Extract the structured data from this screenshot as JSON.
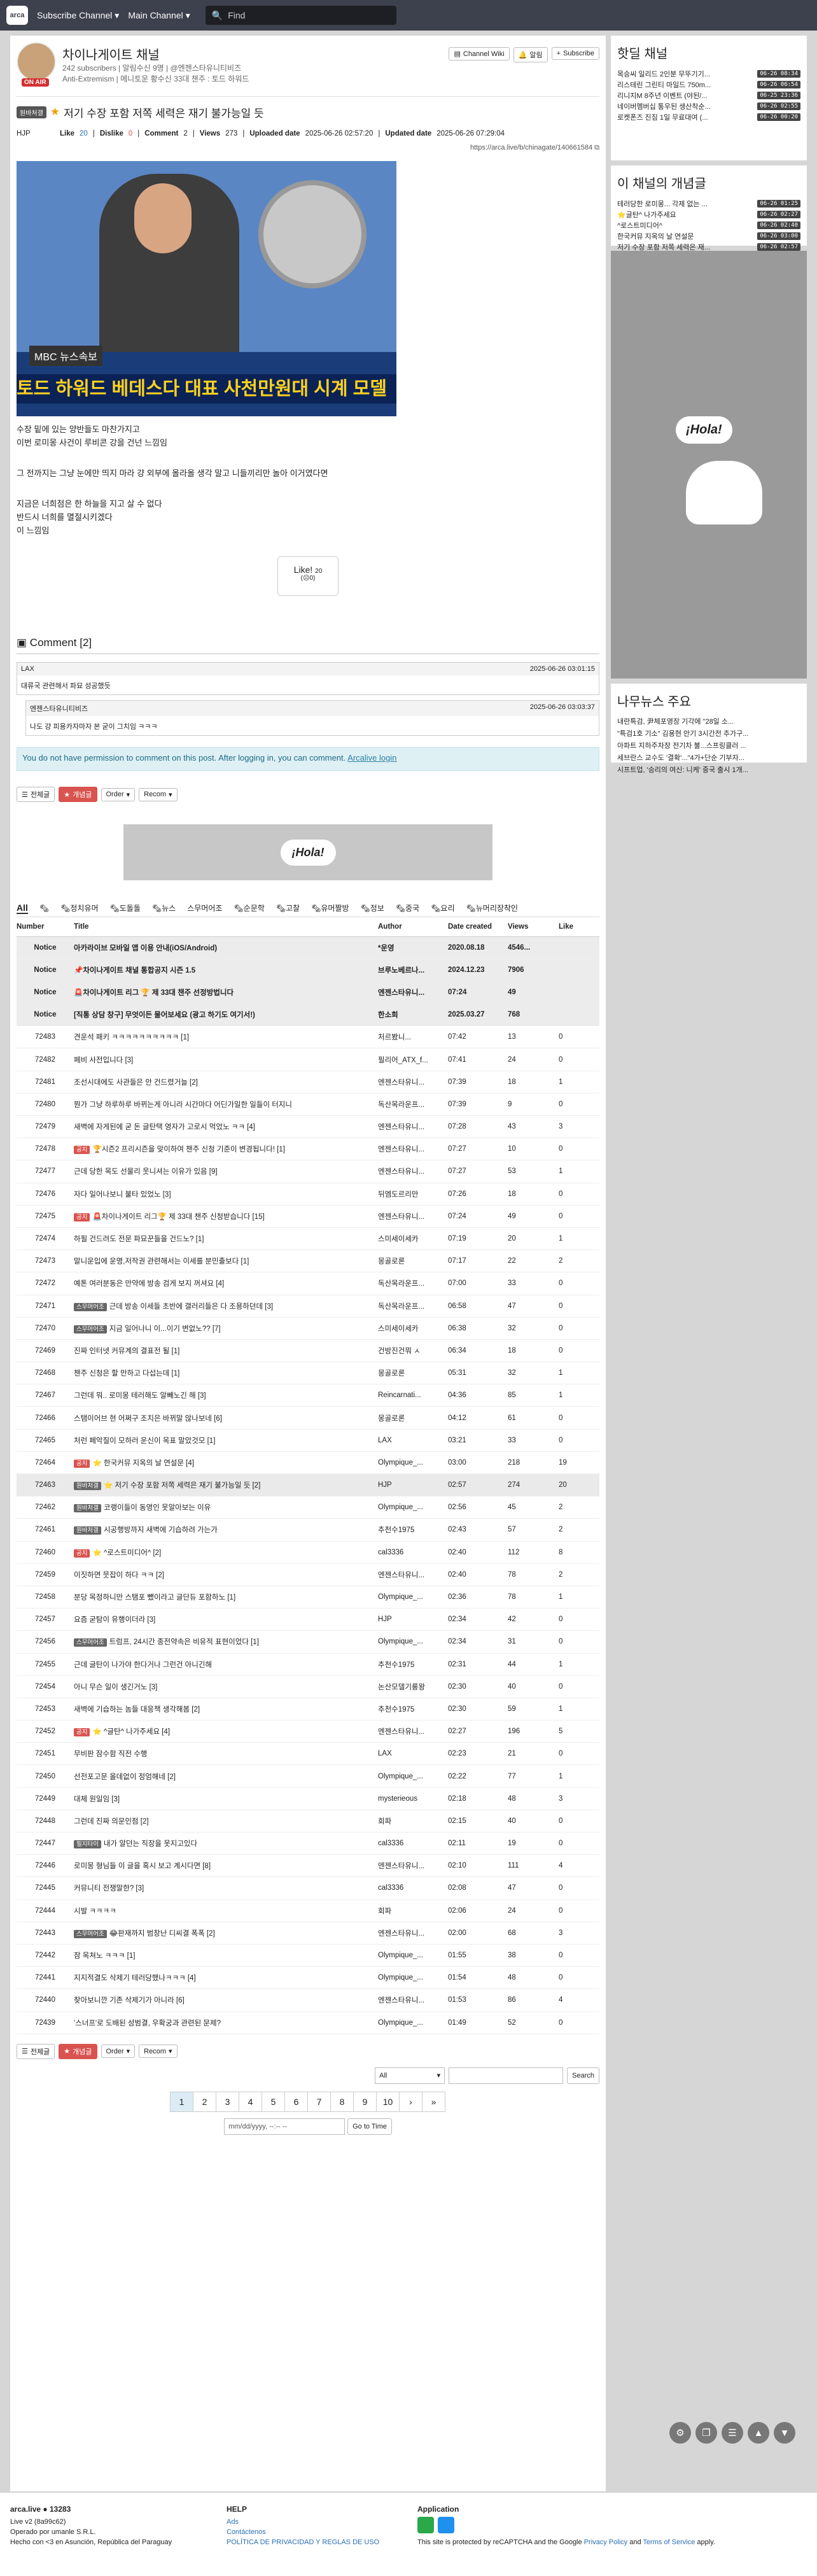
{
  "topbar": {
    "logo": "arca",
    "menu1": "Subscribe Channel",
    "menu2": "Main Channel",
    "search_placeholder": "Find"
  },
  "channel": {
    "name": "차이나게이트 채널",
    "stats": "242 subscribers | 알림수신 9명 | @엔젠스타유니티비즈",
    "desc": "Anti-Extremism | 메니토운 황수신 33대 챈주 : 토드 하워드",
    "onair": "ON AIR",
    "wiki": "Channel Wiki",
    "alert": "알림",
    "subscribe": "Subscribe"
  },
  "post": {
    "category": "원바처갤",
    "title": "저기 수장 포함 저쪽 세력은 재기 불가능일 듯",
    "author": "HJP",
    "like_label": "Like",
    "like": "20",
    "dislike_label": "Dislike",
    "dislike": "0",
    "comment_label": "Comment",
    "comment": "2",
    "views_label": "Views",
    "views": "273",
    "uploaded_label": "Uploaded date",
    "uploaded": "2025-06-26 02:57:20",
    "updated_label": "Updated date",
    "updated": "2025-06-26 07:29:04",
    "link": "https://arca.live/b/chinagate/140661584",
    "image_bug": "MBC 뉴스속보",
    "image_caption": "토드 하워드 베데스다 대표 사천만원대 시계 모델",
    "lines": [
      "수장 밑에 있는 양반들도 마찬가지고",
      "이번 로미몽 사건이 루비콘 강을 건넌 느낌임",
      "",
      "그 전까지는 그냥 눈에만 띄지 마라 걍 외부에 올라올 생각 말고 니들끼리만 놀아 이거였다면",
      "",
      "지금은 너희점은 한 하늘을 지고 살 수 없다",
      "반드시 너희를 멸절시키겠다",
      "이 느낌임"
    ],
    "like_btn": "Like!",
    "like_btn_count": "20",
    "like_btn_sub": "0"
  },
  "comments": {
    "title": "Comment",
    "count": "[2]",
    "items": [
      {
        "author": "LAX",
        "date": "2025-06-26 03:01:15",
        "text": "대류국 관련해서 파묘 성공했듯"
      },
      {
        "author": "엔젠스타유니티비즈",
        "date": "2025-06-26 03:03:37",
        "text": "나도 걍 피용카자마자 본 굳이 그치임 ㅋㅋㅋ"
      }
    ],
    "noperm": "You do not have permission to comment on this post. After logging in, you can comment.",
    "login": "Arcalive login"
  },
  "toolbar": {
    "all": "전체글",
    "best": "개념글",
    "order": "Order",
    "recom": "Recom"
  },
  "ad": {
    "text": "¡Hola!"
  },
  "tabs": [
    "All",
    "🗞",
    "🗞정치유머",
    "🗞도돌돌",
    "🗞뉴스",
    "스무머어조",
    "🗞순문학",
    "🗞고찰",
    "🗞유머짤방",
    "🗞정보",
    "🗞중국",
    "🗞요리",
    "🗞뉴머리장착인"
  ],
  "table": {
    "headers": [
      "Number",
      "Title",
      "Author",
      "Date created",
      "Views",
      "Like"
    ],
    "rows": [
      {
        "n": "Notice",
        "cat": "",
        "t": "아카라이브 모바일 앱 이용 안내(iOS/Android)",
        "a": "*운영",
        "d": "2020.08.18",
        "v": "4546...",
        "l": "",
        "notice": true
      },
      {
        "n": "Notice",
        "cat": "",
        "t": "📌차이나게이트 채널 통합공지 시즌 1.5",
        "a": "브루노베르나...",
        "d": "2024.12.23",
        "v": "7906",
        "l": "",
        "notice": true
      },
      {
        "n": "Notice",
        "cat": "",
        "t": "🚨차이나게이트 리그 🏆 제 33대 챈주 선정방법니다",
        "a": "엔젠스타유니...",
        "d": "07:24",
        "v": "49",
        "l": "",
        "notice": true
      },
      {
        "n": "Notice",
        "cat": "",
        "t": "[직통 상담 창구] 무엇이든 물어보세요 (광고 하기도 여기서!)",
        "a": "한소희",
        "d": "2025.03.27",
        "v": "768",
        "l": "",
        "notice": true
      },
      {
        "n": "72483",
        "cat": "",
        "t": "견운석 패키 ㅋㅋㅋㅋㅋㅋㅋㅋㅋㅋ [1]",
        "a": "처르봤니...",
        "d": "07:42",
        "v": "13",
        "l": "0"
      },
      {
        "n": "72482",
        "cat": "",
        "t": "페비 사전입니다 [3]",
        "a": "필리어_ATX_f...",
        "d": "07:41",
        "v": "24",
        "l": "0"
      },
      {
        "n": "72481",
        "cat": "",
        "t": "조선시대에도 사관들은 안 건드렸거늘 [2]",
        "a": "엔젠스타유니...",
        "d": "07:39",
        "v": "18",
        "l": "1"
      },
      {
        "n": "72480",
        "cat": "",
        "t": "뭔가 그냥 하루하루 바뀌는게 아니라 시간마다 어딘가일한 일들이 터지니",
        "a": "독산목라운프...",
        "d": "07:39",
        "v": "9",
        "l": "0"
      },
      {
        "n": "72479",
        "cat": "",
        "t": "새벽에 자게된에 굳 돈 글탄택 영자가 고로시 먹었노 ㅋㅋ [4]",
        "a": "엔젠스타유니...",
        "d": "07:28",
        "v": "43",
        "l": "3"
      },
      {
        "n": "72478",
        "cat": "공지",
        "t": "🏆시즌2 프리시즌을 맞이하여 챈주 신청 기준이 변경됩니다! [1]",
        "a": "엔젠스타유니...",
        "d": "07:27",
        "v": "10",
        "l": "0"
      },
      {
        "n": "72477",
        "cat": "",
        "t": "근데 당한 목도 선물리 웃니셔는 이유가 있음 [9]",
        "a": "엔젠스타유니...",
        "d": "07:27",
        "v": "53",
        "l": "1"
      },
      {
        "n": "72476",
        "cat": "",
        "t": "자다 일어나보니 불타 있었노 [3]",
        "a": "뒤엠도르리만",
        "d": "07:26",
        "v": "18",
        "l": "0"
      },
      {
        "n": "72475",
        "cat": "공지",
        "t": "🚨차이나게이트 리그🏆 제 33대 챈주 신청받습니다 [15]",
        "a": "엔젠스타유니...",
        "d": "07:24",
        "v": "49",
        "l": "0"
      },
      {
        "n": "72474",
        "cat": "",
        "t": "하필 건드려도 전문 파묘꾼들을 건드노? [1]",
        "a": "스미세이세카",
        "d": "07:19",
        "v": "20",
        "l": "1"
      },
      {
        "n": "72473",
        "cat": "",
        "t": "말니운입에 운명,저작권 관련해서는 이세를 분민출보다 [1]",
        "a": "몽골로론",
        "d": "07:17",
        "v": "22",
        "l": "2"
      },
      {
        "n": "72472",
        "cat": "",
        "t": "예톤 여러분동은 만약에 방송 검게 보지 꺼셔요 [4]",
        "a": "독산목라운프...",
        "d": "07:00",
        "v": "33",
        "l": "0"
      },
      {
        "n": "72471",
        "cat": "스무머어조",
        "t": "근데 방송 이세들 초반에 갤러리들은 다 조용하던데 [3]",
        "a": "독산목라운프...",
        "d": "06:58",
        "v": "47",
        "l": "0"
      },
      {
        "n": "72470",
        "cat": "스무머어조",
        "t": "지금 일어나니 이...이기 변없노?? [7]",
        "a": "스미세이세카",
        "d": "06:38",
        "v": "32",
        "l": "0"
      },
      {
        "n": "72469",
        "cat": "",
        "t": "진짜 인터넷 커뮤계의 결표전 될 [1]",
        "a": "건방진건뭐 ㅅ",
        "d": "06:34",
        "v": "18",
        "l": "0"
      },
      {
        "n": "72468",
        "cat": "",
        "t": "챈주 신청은 할 만하고 다섭는데 [1]",
        "a": "몽골로론",
        "d": "05:31",
        "v": "32",
        "l": "1"
      },
      {
        "n": "72467",
        "cat": "",
        "t": "그런데 뭐.. 로미몽 테러해도 알빼노긴 해 [3]",
        "a": "Reincarnati...",
        "d": "04:36",
        "v": "85",
        "l": "1"
      },
      {
        "n": "72466",
        "cat": "",
        "t": "스탬이어브 현 어쩌구 조치은 바뀌말 않나보네 [6]",
        "a": "몽골로론",
        "d": "04:12",
        "v": "61",
        "l": "0"
      },
      {
        "n": "72465",
        "cat": "",
        "t": "처런 페악질이 모하러 운신이 목표 말았것모 [1]",
        "a": "LAX",
        "d": "03:21",
        "v": "33",
        "l": "0"
      },
      {
        "n": "72464",
        "cat": "공지",
        "t": "⭐ 한국커뮤 지옥의 날 연설문 [4]",
        "a": "Olympique_...",
        "d": "03:00",
        "v": "218",
        "l": "19"
      },
      {
        "n": "72463",
        "cat": "원바처갤",
        "t": "⭐ 저기 수장 포함 저쪽 세력은 재기 불가능일 듯 [2]",
        "a": "HJP",
        "d": "02:57",
        "v": "274",
        "l": "20",
        "hl": true
      },
      {
        "n": "72462",
        "cat": "원바처갤",
        "t": "코랭이들이 동영인 못알아보는 이유",
        "a": "Olympique_...",
        "d": "02:56",
        "v": "45",
        "l": "2"
      },
      {
        "n": "72461",
        "cat": "원바처갤",
        "t": "시공행방까지 새벽에 기습하려 가는가",
        "a": "추천수1975",
        "d": "02:43",
        "v": "57",
        "l": "2"
      },
      {
        "n": "72460",
        "cat": "공지",
        "t": "⭐ ^로스트미디어^ [2]",
        "a": "cal3336",
        "d": "02:40",
        "v": "112",
        "l": "8"
      },
      {
        "n": "72459",
        "cat": "",
        "t": "이짓하면 뭇잡이 하다 ㅋㅋ [2]",
        "a": "엔젠스타유니...",
        "d": "02:40",
        "v": "78",
        "l": "2"
      },
      {
        "n": "72458",
        "cat": "",
        "t": "분당 목정하니만 스탬포 뺐이라고 글단듀 포함하노 [1]",
        "a": "Olympique_...",
        "d": "02:36",
        "v": "78",
        "l": "1"
      },
      {
        "n": "72457",
        "cat": "",
        "t": "요즘 굳탐이 유행이더라 [3]",
        "a": "HJP",
        "d": "02:34",
        "v": "42",
        "l": "0"
      },
      {
        "n": "72456",
        "cat": "스무머어조",
        "t": "트럼프, 24시간 종전약속은 비유적 표현이었다 [1]",
        "a": "Olympique_...",
        "d": "02:34",
        "v": "31",
        "l": "0"
      },
      {
        "n": "72455",
        "cat": "",
        "t": "근데 글탄이 나가야 한다거나 그런건 아니긴해",
        "a": "추천수1975",
        "d": "02:31",
        "v": "44",
        "l": "1"
      },
      {
        "n": "72454",
        "cat": "",
        "t": "아니 무슨 일이 생긴거노 [3]",
        "a": "논산모델기룡왕",
        "d": "02:30",
        "v": "40",
        "l": "0"
      },
      {
        "n": "72453",
        "cat": "",
        "t": "새벽에 기습하는 놈들 대응책 생각해봄 [2]",
        "a": "추천수1975",
        "d": "02:30",
        "v": "59",
        "l": "1"
      },
      {
        "n": "72452",
        "cat": "공지",
        "t": "⭐ ^글탄^ 나가주세요 [4]",
        "a": "엔젠스타유니...",
        "d": "02:27",
        "v": "196",
        "l": "5"
      },
      {
        "n": "72451",
        "cat": "",
        "t": "무비판 잠수함 직전 수행",
        "a": "LAX",
        "d": "02:23",
        "v": "21",
        "l": "0"
      },
      {
        "n": "72450",
        "cat": "",
        "t": "선전포고문 올데없이 정엄해네 [2]",
        "a": "Olympique_...",
        "d": "02:22",
        "v": "77",
        "l": "1"
      },
      {
        "n": "72449",
        "cat": "",
        "t": "대체 원일임 [3]",
        "a": "mysterieous",
        "d": "02:18",
        "v": "48",
        "l": "3"
      },
      {
        "n": "72448",
        "cat": "",
        "t": "그런데 진짜 의문인점 [2]",
        "a": "회파",
        "d": "02:15",
        "v": "40",
        "l": "0"
      },
      {
        "n": "72447",
        "cat": "필지타이",
        "t": "내가 알던는 직장을 못지고있다",
        "a": "cal3336",
        "d": "02:11",
        "v": "19",
        "l": "0"
      },
      {
        "n": "72446",
        "cat": "",
        "t": "로미몽 형님들 이 글을 혹시 보고 계시다면 [8]",
        "a": "엔젠스타유니...",
        "d": "02:10",
        "v": "111",
        "l": "4"
      },
      {
        "n": "72445",
        "cat": "",
        "t": "커뮤니티 전쟁말한? [3]",
        "a": "cal3336",
        "d": "02:08",
        "v": "47",
        "l": "0"
      },
      {
        "n": "72444",
        "cat": "",
        "t": "시발 ㅋㅋㅋㅋ",
        "a": "회파",
        "d": "02:06",
        "v": "24",
        "l": "0"
      },
      {
        "n": "72443",
        "cat": "스무머어조",
        "t": "😂판재까지 범창난 디씨결 폭폭 [2]",
        "a": "엔젠스타유니...",
        "d": "02:00",
        "v": "68",
        "l": "3"
      },
      {
        "n": "72442",
        "cat": "",
        "t": "잠 목쳐노 ㅋㅋㅋ [1]",
        "a": "Olympique_...",
        "d": "01:55",
        "v": "38",
        "l": "0"
      },
      {
        "n": "72441",
        "cat": "",
        "t": "지지적결도 삭제기 테러당했나ㅋㅋㅋ [4]",
        "a": "Olympique_...",
        "d": "01:54",
        "v": "48",
        "l": "0"
      },
      {
        "n": "72440",
        "cat": "",
        "t": "찾아보니깐 기존 삭제기가 아니라 [6]",
        "a": "엔젠스타유니...",
        "d": "01:53",
        "v": "86",
        "l": "4"
      },
      {
        "n": "72439",
        "cat": "",
        "t": "'스너프'로 도배된 성범결, 우확궁과 관련된 문제?",
        "a": "Olympique_...",
        "d": "01:49",
        "v": "52",
        "l": "0"
      }
    ]
  },
  "search": {
    "scope": "All",
    "button": "Search"
  },
  "pager": {
    "pages": [
      "1",
      "2",
      "3",
      "4",
      "5",
      "6",
      "7",
      "8",
      "9",
      "10"
    ],
    "next": "›",
    "last": "»",
    "current": "1"
  },
  "datejump": {
    "placeholder": "mm/dd/yyyy, --:-- --",
    "button": "Go to Time"
  },
  "side": {
    "hot_title": "핫딜 채널",
    "hot": [
      {
        "t": "목승씨 일리드 2인분 무뚜기기...",
        "d": "06-26 08:34"
      },
      {
        "t": "리스테린 그린티 마일드 750m...",
        "d": "06-26 06:54"
      },
      {
        "t": "리니지M 8주년 이벤트 (야된/...",
        "d": "06-25 23:36"
      },
      {
        "t": "네이버멤버십 통우된 생산착순...",
        "d": "06-26 02:55"
      },
      {
        "t": "로켓폰즈 진짐 1일 무료대여 (...",
        "d": "06-26 00:20"
      }
    ],
    "best_title": "이 채널의 개념글",
    "best": [
      {
        "t": "테러당한 로미몽... 각제 없는 ...",
        "d": "06-26 01:25"
      },
      {
        "t": "⭐글탄^ 나가주세요",
        "d": "06-26 02:27"
      },
      {
        "t": "^로스트미디어^",
        "d": "06-26 02:40"
      },
      {
        "t": "한국커뮤 지옥의 날 연설문",
        "d": "06-26 03:00"
      },
      {
        "t": "저기 수장 포함 저쪽 세력은 재...",
        "d": "06-26 02:57"
      }
    ],
    "ad": "¡Hola!",
    "news_title": "나무뉴스 주요",
    "news": [
      "내란특검, 尹체포영장 기각에 \"28일 소...",
      "\"특검1호 기소\" 김용현 안기 3시간전 추가구...",
      "아파트 지하주차장 전기차 불...스프링클러 ...",
      "세브란스 교수도 '결확'...\"4가+단순 기부자...",
      "시프트업, '승리의 여신: 니케' 중국 출시 1개..."
    ]
  },
  "footer": {
    "brand": "arca.live",
    "count": "13283",
    "version": "Live v2 (8a99c62)",
    "operator": "Operado por umanle S.R.L.",
    "location": "Hecho con <3 en Asunción, República del Paraguay",
    "help_title": "HELP",
    "help": [
      "Ads",
      "Contáctenos",
      "POLÍTICA DE PRIVACIDAD Y REGLAS DE USO"
    ],
    "app_title": "Application",
    "recaptcha_a": "This site is protected by reCAPTCHA and the Google ",
    "privacy": "Privacy Policy",
    "and": " and ",
    "terms": "Terms of Service",
    "apply": " apply."
  }
}
